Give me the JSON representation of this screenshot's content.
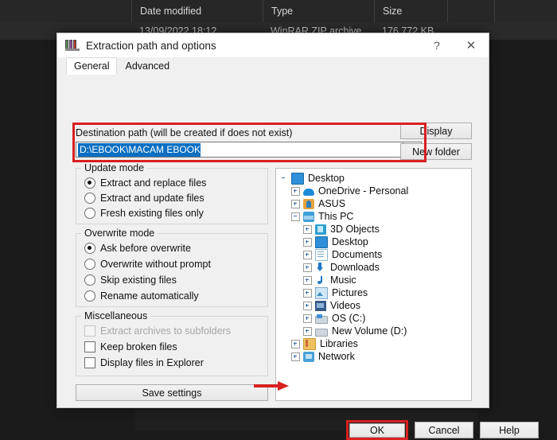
{
  "background": {
    "columns": [
      "",
      "Date modified",
      "Type",
      "Size",
      ""
    ],
    "row": {
      "date_modified": "13/09/2022 18:12",
      "type": "WinRAR ZIP archive",
      "size": "176 772 KB"
    }
  },
  "dialog": {
    "title": "Extraction path and options",
    "icon": "winrar-books-icon",
    "help_button": "?",
    "close_button": "✕",
    "tabs": [
      {
        "label": "General",
        "active": true
      },
      {
        "label": "Advanced",
        "active": false
      }
    ],
    "destination": {
      "label": "Destination path (will be created if does not exist)",
      "value": "D:\\EBOOK\\MACAM EBOOK",
      "selected": true,
      "dropdown_icon": "chevron-down-icon"
    },
    "side_buttons": {
      "display": "Display",
      "new_folder": "New folder"
    },
    "groups": {
      "update_mode": {
        "title": "Update mode",
        "options": [
          {
            "label": "Extract and replace files",
            "selected": true
          },
          {
            "label": "Extract and update files",
            "selected": false
          },
          {
            "label": "Fresh existing files only",
            "selected": false
          }
        ]
      },
      "overwrite_mode": {
        "title": "Overwrite mode",
        "options": [
          {
            "label": "Ask before overwrite",
            "selected": true
          },
          {
            "label": "Overwrite without prompt",
            "selected": false
          },
          {
            "label": "Skip existing files",
            "selected": false
          },
          {
            "label": "Rename automatically",
            "selected": false
          }
        ]
      },
      "miscellaneous": {
        "title": "Miscellaneous",
        "options": [
          {
            "label": "Extract archives to subfolders",
            "checked": false,
            "disabled": true
          },
          {
            "label": "Keep broken files",
            "checked": false,
            "disabled": false
          },
          {
            "label": "Display files in Explorer",
            "checked": false,
            "disabled": false
          }
        ]
      }
    },
    "save_settings": "Save settings",
    "tree": [
      {
        "label": "Desktop",
        "indent": 0,
        "expander": "none",
        "icon": "desktop-icon"
      },
      {
        "label": "OneDrive - Personal",
        "indent": 1,
        "expander": "plus",
        "icon": "cloud-icon"
      },
      {
        "label": "ASUS",
        "indent": 1,
        "expander": "plus",
        "icon": "user-icon"
      },
      {
        "label": "This PC",
        "indent": 1,
        "expander": "minus",
        "icon": "pc-icon"
      },
      {
        "label": "3D Objects",
        "indent": 2,
        "expander": "plus",
        "icon": "3d-objects-icon"
      },
      {
        "label": "Desktop",
        "indent": 2,
        "expander": "plus",
        "icon": "desktop-icon"
      },
      {
        "label": "Documents",
        "indent": 2,
        "expander": "plus",
        "icon": "documents-icon"
      },
      {
        "label": "Downloads",
        "indent": 2,
        "expander": "plus",
        "icon": "downloads-icon"
      },
      {
        "label": "Music",
        "indent": 2,
        "expander": "plus",
        "icon": "music-icon"
      },
      {
        "label": "Pictures",
        "indent": 2,
        "expander": "plus",
        "icon": "pictures-icon"
      },
      {
        "label": "Videos",
        "indent": 2,
        "expander": "plus",
        "icon": "videos-icon"
      },
      {
        "label": "OS (C:)",
        "indent": 2,
        "expander": "plus",
        "icon": "os-drive-icon"
      },
      {
        "label": "New Volume (D:)",
        "indent": 2,
        "expander": "plus",
        "icon": "drive-icon"
      },
      {
        "label": "Libraries",
        "indent": 1,
        "expander": "plus",
        "icon": "libraries-icon"
      },
      {
        "label": "Network",
        "indent": 1,
        "expander": "plus",
        "icon": "network-icon"
      }
    ],
    "footer": {
      "ok": "OK",
      "cancel": "Cancel",
      "help": "Help"
    }
  },
  "annotations": {
    "highlight_color": "#d82020",
    "arrow_target": "ok-button"
  }
}
